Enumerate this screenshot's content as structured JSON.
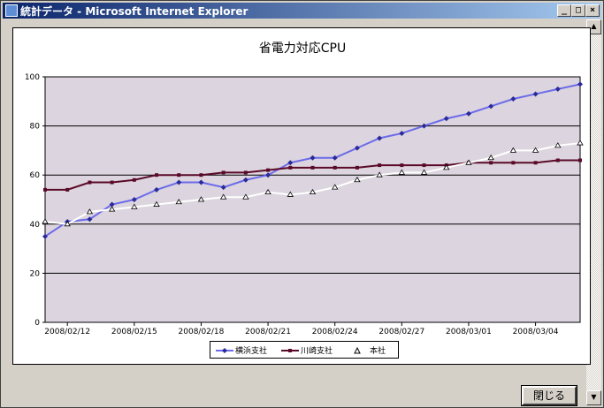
{
  "window": {
    "title": "統計データ - Microsoft Internet Explorer"
  },
  "controls": {
    "minimize": "_",
    "maximize": "□",
    "close": "×"
  },
  "scrollbar": {
    "up": "▲",
    "down": "▼"
  },
  "buttons": {
    "close_label": "閉じる"
  },
  "chart_data": {
    "type": "line",
    "title": "省電力対応CPU",
    "ylim": [
      0,
      100
    ],
    "yticks": [
      "0",
      "20",
      "40",
      "60",
      "80",
      "100"
    ],
    "xticks": [
      "2008/02/12",
      "2008/02/15",
      "2008/02/18",
      "2008/02/21",
      "2008/02/24",
      "2008/02/27",
      "2008/03/01",
      "2008/03/04"
    ],
    "x": [
      "2008/02/11",
      "2008/02/12",
      "2008/02/13",
      "2008/02/14",
      "2008/02/15",
      "2008/02/16",
      "2008/02/17",
      "2008/02/18",
      "2008/02/19",
      "2008/02/20",
      "2008/02/21",
      "2008/02/22",
      "2008/02/23",
      "2008/02/24",
      "2008/02/25",
      "2008/02/26",
      "2008/02/27",
      "2008/02/28",
      "2008/02/29",
      "2008/03/01",
      "2008/03/02",
      "2008/03/03",
      "2008/03/04",
      "2008/03/05",
      "2008/03/06"
    ],
    "grid": true,
    "legend": "bottom",
    "series": [
      {
        "name": "横浜支社",
        "color": "#6b6bea",
        "marker": "diamond",
        "values": [
          35,
          41,
          42,
          48,
          50,
          54,
          57,
          57,
          55,
          58,
          60,
          65,
          67,
          67,
          71,
          75,
          77,
          80,
          83,
          85,
          88,
          91,
          93,
          95,
          97
        ]
      },
      {
        "name": "川崎支社",
        "color": "#5a0a28",
        "marker": "square",
        "values": [
          54,
          54,
          57,
          57,
          58,
          60,
          60,
          60,
          61,
          61,
          62,
          63,
          63,
          63,
          63,
          64,
          64,
          64,
          64,
          65,
          65,
          65,
          65,
          66,
          66
        ]
      },
      {
        "name": "本社",
        "color": "#ffffff",
        "marker": "triangle",
        "values": [
          41,
          40,
          45,
          46,
          47,
          48,
          49,
          50,
          51,
          51,
          53,
          52,
          53,
          55,
          58,
          60,
          61,
          61,
          63,
          65,
          67,
          70,
          70,
          72,
          73
        ]
      }
    ]
  }
}
